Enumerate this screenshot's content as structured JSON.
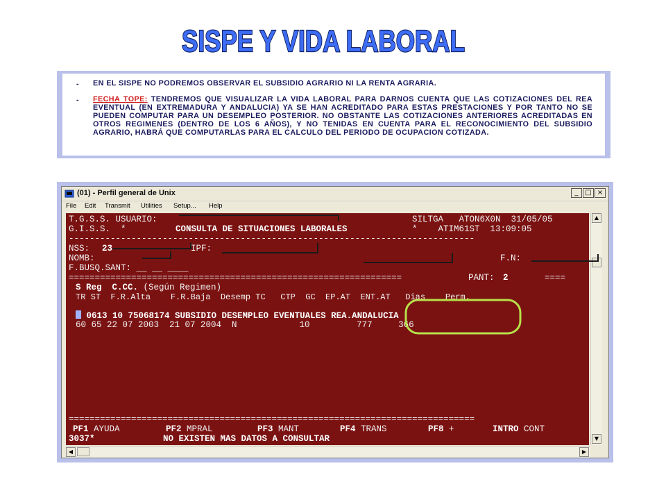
{
  "slide": {
    "title": "SISPE Y VIDA LABORAL",
    "bullets": [
      {
        "marker": "-",
        "text": "EN EL SISPE NO PODREMOS OBSERVAR EL SUBSIDIO AGRARIO NI LA RENTA AGRARIA."
      },
      {
        "marker": "-",
        "highlight": "FECHA TOPE:",
        "text": " TENDREMOS QUE VISUALIZAR LA VIDA LABORAL PARA DARNOS CUENTA QUE LAS COTIZACIONES DEL REA EVENTUAL (EN EXTREMADURA Y ANDALUCIA) YA SE HAN ACREDITADO PARA ESTAS PRESTACIONES Y POR TANTO NO SE PUEDEN COMPUTAR PARA UN DESEMPLEO POSTERIOR. NO OBSTANTE LAS COTIZACIONES ANTERIORES ACREDITADAS EN OTROS REGIMENES (DENTRO DE LOS 6 AÑOS), Y NO TENIDAS EN CUENTA PARA EL RECONOCIMIENTO DEL SUBSIDIO AGRARIO, HABRÁ QUE COMPUTARLAS PARA EL CALCULO DEL PERIODO DE OCUPACION COTIZADA."
      }
    ]
  },
  "window": {
    "title": "(01) - Perfil general de Unix",
    "controls": {
      "minimize": "_",
      "maximize": "□",
      "close": "×"
    },
    "menu": [
      "File",
      "Edit",
      "Transmit",
      "Utilities",
      "Setup...",
      "Help"
    ]
  },
  "terminal": {
    "line1": {
      "left": "T.G.S.S. USUARIO:",
      "right": "SILTGA   ATON6X0N  31/05/05"
    },
    "line2": {
      "left": "G.I.S.S.  *",
      "center": "CONSULTA DE SITUACIONES LABORALES",
      "right": "*    ATIM61ST  13:09:05"
    },
    "divider1": "------------------------------------------------------------------------------",
    "line3": {
      "nss_label": "NSS:",
      "nss_value": "23",
      "ipf_label": "IPF:"
    },
    "line4": {
      "nomb_label": "NOMB:",
      "fn_label": "F.N:"
    },
    "line5": "F.BUSQ.SANT: __ __ ____",
    "line6": {
      "rule": "================================================================",
      "pant_label": "PANT:",
      "pant_value": "2",
      "end": "===="
    },
    "header1": {
      "bold": "S Reg  C.CC.",
      "normal": "(Según Regimen)"
    },
    "header2": "TR ST  F.R.Alta    F.R.Baja  Desemp TC   CTP  GC  EP.AT  ENT.AT   Dias    Perm.",
    "record1": "0613 10 75068174 SUBSIDIO DESEMPLEO EVENTUALES REA.ANDALUCIA",
    "record2": "60 65 22 07 2003  21 07 2004  N            10         777     366",
    "divider2": "==============================================================================",
    "pf": [
      {
        "key": "PF1",
        "label": "AYUDA"
      },
      {
        "key": "PF2",
        "label": "MPRAL"
      },
      {
        "key": "PF3",
        "label": "MANT"
      },
      {
        "key": "PF4",
        "label": "TRANS"
      },
      {
        "key": "PF8",
        "label": "+"
      },
      {
        "key": "INTRO",
        "label": "CONT"
      }
    ],
    "status_code": "3037*",
    "status_message": "NO EXISTEN MAS DATOS A CONSULTAR"
  },
  "colors": {
    "terminal_bg": "#7b1212",
    "terminal_text": "#f2f2f2",
    "highlight_circle": "#b7e04a",
    "title_fill": "#3d6cf5",
    "info_border": "#b9c0ea",
    "emphasis_red": "#d0201f"
  },
  "icons": [
    "app-icon",
    "minimize-icon",
    "maximize-icon",
    "close-icon",
    "scroll-up-icon",
    "scroll-down-icon",
    "scroll-left-icon",
    "scroll-right-icon"
  ]
}
